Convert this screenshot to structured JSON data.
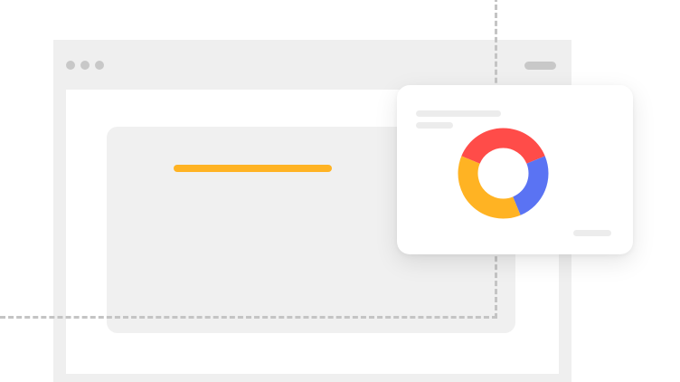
{
  "colors": {
    "accent_bar": "#ffb323",
    "donut_red": "#ff4c49",
    "donut_blue": "#5a73f3",
    "donut_yellow": "#ffb323"
  },
  "browser": {
    "dots": [
      "dot",
      "dot",
      "dot"
    ]
  },
  "donut": {
    "segments": [
      {
        "color": "#ff4c49",
        "fraction": 0.375
      },
      {
        "color": "#5a73f3",
        "fraction": 0.25
      },
      {
        "color": "#ffb323",
        "fraction": 0.375
      }
    ]
  }
}
